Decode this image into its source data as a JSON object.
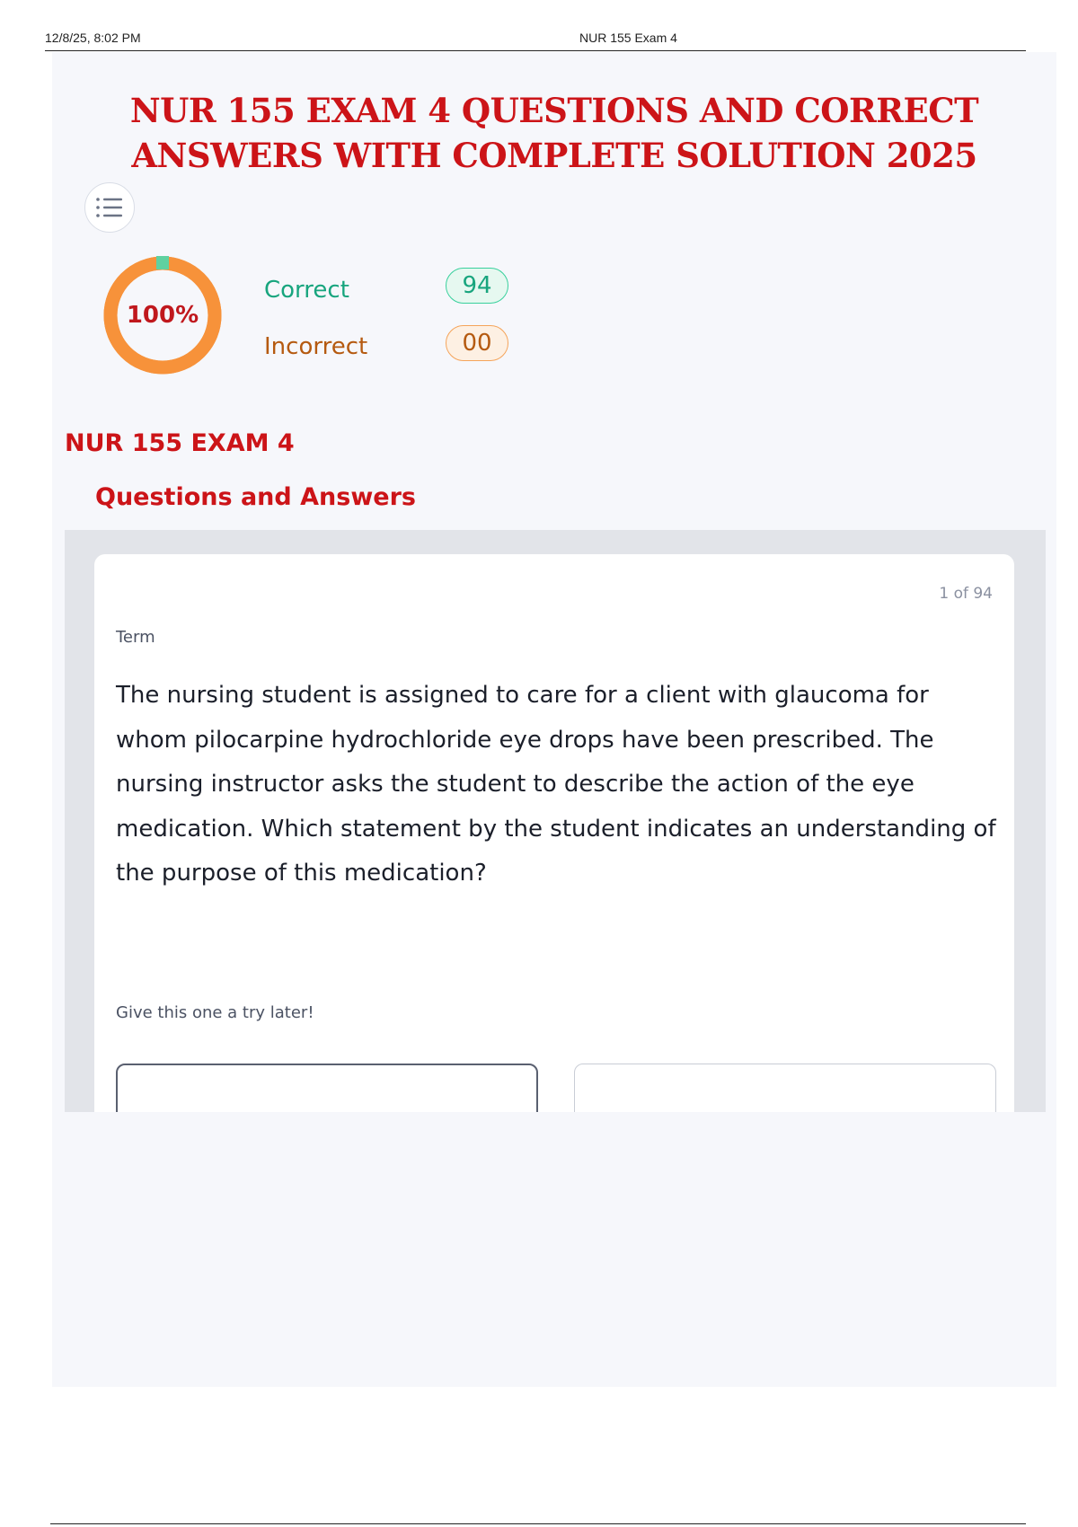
{
  "print_header": {
    "date": "12/8/25, 8:02 PM",
    "doc_title": "NUR 155 Exam 4"
  },
  "title_line1": "NUR 155 EXAM 4 QUESTIONS AND CORRECT",
  "title_line2": "ANSWERS WITH COMPLETE SOLUTION 2025",
  "toc_icon": "list-icon",
  "score": {
    "percent_label": "100%",
    "fraction_correct": 1.0,
    "correct_label": "Correct",
    "correct_count": "94",
    "incorrect_label": "Incorrect",
    "incorrect_count": "00"
  },
  "section": {
    "title": "NUR 155 EXAM 4",
    "subtitle": "Questions and Answers"
  },
  "card": {
    "counter": "1 of 94",
    "term_label": "Term",
    "question": "The nursing student is assigned to care for a client with glaucoma for whom pilocarpine hydrochloride eye drops have been prescribed. The nursing instructor asks the student to describe the action of the eye medication. Which statement by the student indicates an understanding of the purpose of this medication?",
    "hint": "Give this one a try later!"
  },
  "colors": {
    "title_red": "#cc1418",
    "donut_orange": "#f7923a",
    "donut_green": "#5fd1a0",
    "correct_green": "#18a57e",
    "incorrect_brown": "#b55a10",
    "page_bg": "#f6f7fb",
    "card_frame_bg": "#e2e4e9"
  }
}
